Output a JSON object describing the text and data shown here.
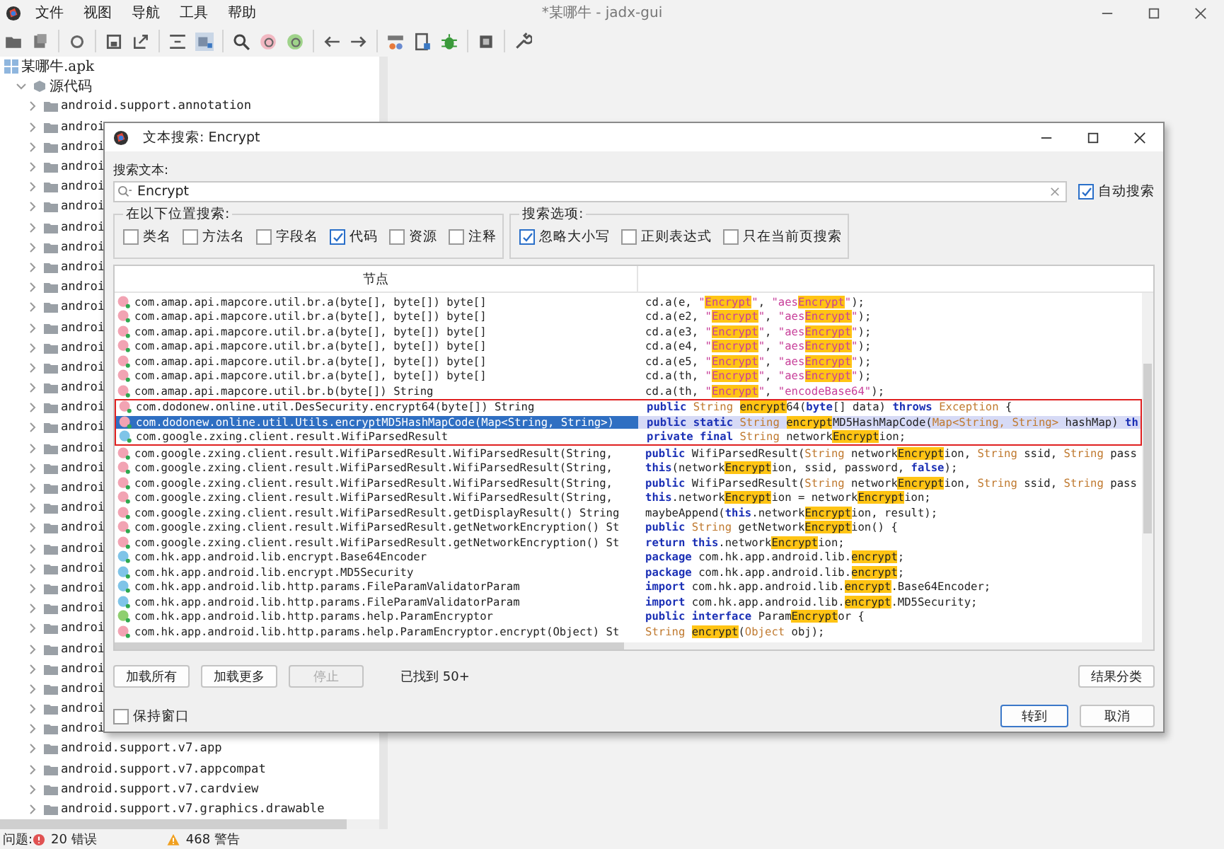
{
  "window": {
    "title": "*某哪牛 - jadx-gui"
  },
  "menu": [
    "文件",
    "视图",
    "导航",
    "工具",
    "帮助"
  ],
  "tree": [
    {
      "label": "某哪牛.apk",
      "kind": "apk",
      "children": [
        {
          "label": "源代码",
          "kind": "sources",
          "expanded": true,
          "children": [
            {
              "label": "android.support.annotation",
              "kind": "package",
              "expanded": false
            },
            {
              "label": "androi",
              "kind": "package",
              "expanded": false
            },
            {
              "label": "androi",
              "kind": "package",
              "expanded": false
            },
            {
              "label": "androi",
              "kind": "package",
              "expanded": false
            },
            {
              "label": "androi",
              "kind": "package",
              "expanded": false
            },
            {
              "label": "androi",
              "kind": "package",
              "expanded": false
            },
            {
              "label": "androi",
              "kind": "package",
              "expanded": false
            },
            {
              "label": "androi",
              "kind": "package",
              "expanded": false
            },
            {
              "label": "androi",
              "kind": "package",
              "expanded": false
            },
            {
              "label": "androi",
              "kind": "package",
              "expanded": false
            },
            {
              "label": "androi",
              "kind": "package",
              "expanded": false
            },
            {
              "label": "androi",
              "kind": "package",
              "expanded": false
            },
            {
              "label": "androi",
              "kind": "package",
              "expanded": false
            },
            {
              "label": "androi",
              "kind": "package",
              "expanded": false
            },
            {
              "label": "androi",
              "kind": "package",
              "expanded": false
            },
            {
              "label": "androi",
              "kind": "package",
              "expanded": false
            },
            {
              "label": "androi",
              "kind": "package",
              "expanded": false
            },
            {
              "label": "androi",
              "kind": "package",
              "expanded": false
            },
            {
              "label": "androi",
              "kind": "package",
              "expanded": false
            },
            {
              "label": "androi",
              "kind": "package",
              "expanded": false
            },
            {
              "label": "androi",
              "kind": "package",
              "expanded": false
            },
            {
              "label": "androi",
              "kind": "package",
              "expanded": false
            },
            {
              "label": "androi",
              "kind": "package",
              "expanded": false
            },
            {
              "label": "androi",
              "kind": "package",
              "expanded": false
            },
            {
              "label": "androi",
              "kind": "package",
              "expanded": false
            },
            {
              "label": "androi",
              "kind": "package",
              "expanded": false
            },
            {
              "label": "androi",
              "kind": "package",
              "expanded": false
            },
            {
              "label": "androi",
              "kind": "package",
              "expanded": false
            },
            {
              "label": "androi",
              "kind": "package",
              "expanded": false
            },
            {
              "label": "androi",
              "kind": "package",
              "expanded": false
            },
            {
              "label": "androi",
              "kind": "package",
              "expanded": false
            },
            {
              "label": "androi",
              "kind": "package",
              "expanded": false
            },
            {
              "label": "android.support.v7.app",
              "kind": "package",
              "expanded": false
            },
            {
              "label": "android.support.v7.appcompat",
              "kind": "package",
              "expanded": false
            },
            {
              "label": "android.support.v7.cardview",
              "kind": "package",
              "expanded": false
            },
            {
              "label": "android.support.v7.graphics.drawable",
              "kind": "package",
              "expanded": false
            }
          ]
        }
      ]
    }
  ],
  "dialog": {
    "title": "文本搜索: Encrypt",
    "search_label": "搜索文本:",
    "query": "Encrypt",
    "auto_search": {
      "label": "自动搜索",
      "checked": true
    },
    "scope": {
      "title": "在以下位置搜索:",
      "options": [
        {
          "label": "类名",
          "checked": false
        },
        {
          "label": "方法名",
          "checked": false
        },
        {
          "label": "字段名",
          "checked": false
        },
        {
          "label": "代码",
          "checked": true
        },
        {
          "label": "资源",
          "checked": false
        },
        {
          "label": "注释",
          "checked": false
        }
      ]
    },
    "search_options": {
      "title": "搜索选项:",
      "options": [
        {
          "label": "忽略大小写",
          "checked": true
        },
        {
          "label": "正则表达式",
          "checked": false
        },
        {
          "label": "只在当前页搜索",
          "checked": false
        }
      ]
    },
    "results": {
      "columns": [
        "节点"
      ],
      "rows": [
        {
          "kind": "method",
          "name": "com.amap.api.mapcore.util.br.a(byte[], byte[]) byte[]",
          "selected": false,
          "code": [
            {
              "text": "cd.a(e, ",
              "kind": "plain"
            },
            {
              "text": "\"",
              "kind": "str"
            },
            {
              "text": "Encrypt",
              "kind": "strhit"
            },
            {
              "text": "\"",
              "kind": "str"
            },
            {
              "text": ", ",
              "kind": "plain"
            },
            {
              "text": "\"aes",
              "kind": "str"
            },
            {
              "text": "Encrypt",
              "kind": "strhit"
            },
            {
              "text": "\"",
              "kind": "str"
            },
            {
              "text": ");",
              "kind": "plain"
            }
          ]
        },
        {
          "kind": "method",
          "name": "com.amap.api.mapcore.util.br.a(byte[], byte[]) byte[]",
          "selected": false,
          "code": [
            {
              "text": "cd.a(e2, ",
              "kind": "plain"
            },
            {
              "text": "\"",
              "kind": "str"
            },
            {
              "text": "Encrypt",
              "kind": "strhit"
            },
            {
              "text": "\"",
              "kind": "str"
            },
            {
              "text": ", ",
              "kind": "plain"
            },
            {
              "text": "\"aes",
              "kind": "str"
            },
            {
              "text": "Encrypt",
              "kind": "strhit"
            },
            {
              "text": "\"",
              "kind": "str"
            },
            {
              "text": ");",
              "kind": "plain"
            }
          ]
        },
        {
          "kind": "method",
          "name": "com.amap.api.mapcore.util.br.a(byte[], byte[]) byte[]",
          "selected": false,
          "code": [
            {
              "text": "cd.a(e3, ",
              "kind": "plain"
            },
            {
              "text": "\"",
              "kind": "str"
            },
            {
              "text": "Encrypt",
              "kind": "strhit"
            },
            {
              "text": "\"",
              "kind": "str"
            },
            {
              "text": ", ",
              "kind": "plain"
            },
            {
              "text": "\"aes",
              "kind": "str"
            },
            {
              "text": "Encrypt",
              "kind": "strhit"
            },
            {
              "text": "\"",
              "kind": "str"
            },
            {
              "text": ");",
              "kind": "plain"
            }
          ]
        },
        {
          "kind": "method",
          "name": "com.amap.api.mapcore.util.br.a(byte[], byte[]) byte[]",
          "selected": false,
          "code": [
            {
              "text": "cd.a(e4, ",
              "kind": "plain"
            },
            {
              "text": "\"",
              "kind": "str"
            },
            {
              "text": "Encrypt",
              "kind": "strhit"
            },
            {
              "text": "\"",
              "kind": "str"
            },
            {
              "text": ", ",
              "kind": "plain"
            },
            {
              "text": "\"aes",
              "kind": "str"
            },
            {
              "text": "Encrypt",
              "kind": "strhit"
            },
            {
              "text": "\"",
              "kind": "str"
            },
            {
              "text": ");",
              "kind": "plain"
            }
          ]
        },
        {
          "kind": "method",
          "name": "com.amap.api.mapcore.util.br.a(byte[], byte[]) byte[]",
          "selected": false,
          "code": [
            {
              "text": "cd.a(e5, ",
              "kind": "plain"
            },
            {
              "text": "\"",
              "kind": "str"
            },
            {
              "text": "Encrypt",
              "kind": "strhit"
            },
            {
              "text": "\"",
              "kind": "str"
            },
            {
              "text": ", ",
              "kind": "plain"
            },
            {
              "text": "\"aes",
              "kind": "str"
            },
            {
              "text": "Encrypt",
              "kind": "strhit"
            },
            {
              "text": "\"",
              "kind": "str"
            },
            {
              "text": ");",
              "kind": "plain"
            }
          ]
        },
        {
          "kind": "method",
          "name": "com.amap.api.mapcore.util.br.a(byte[], byte[]) byte[]",
          "selected": false,
          "code": [
            {
              "text": "cd.a(th, ",
              "kind": "plain"
            },
            {
              "text": "\"",
              "kind": "str"
            },
            {
              "text": "Encrypt",
              "kind": "strhit"
            },
            {
              "text": "\"",
              "kind": "str"
            },
            {
              "text": ", ",
              "kind": "plain"
            },
            {
              "text": "\"aes",
              "kind": "str"
            },
            {
              "text": "Encrypt",
              "kind": "strhit"
            },
            {
              "text": "\"",
              "kind": "str"
            },
            {
              "text": ");",
              "kind": "plain"
            }
          ]
        },
        {
          "kind": "method",
          "name": "com.amap.api.mapcore.util.br.b(byte[]) String",
          "selected": false,
          "code": [
            {
              "text": "cd.a(th, ",
              "kind": "plain"
            },
            {
              "text": "\"",
              "kind": "str"
            },
            {
              "text": "Encrypt",
              "kind": "strhit"
            },
            {
              "text": "\"",
              "kind": "str"
            },
            {
              "text": ", ",
              "kind": "plain"
            },
            {
              "text": "\"encodeBase64\"",
              "kind": "str"
            },
            {
              "text": ");",
              "kind": "plain"
            }
          ]
        },
        {
          "kind": "method",
          "name": "com.dodonew.online.util.DesSecurity.encrypt64(byte[]) String",
          "selected": false,
          "code": [
            {
              "text": "public ",
              "kind": "kw"
            },
            {
              "text": "String ",
              "kind": "type"
            },
            {
              "text": "encrypt",
              "kind": "hit"
            },
            {
              "text": "64(",
              "kind": "plain"
            },
            {
              "text": "byte",
              "kind": "kw"
            },
            {
              "text": "[] data) ",
              "kind": "plain"
            },
            {
              "text": "throws ",
              "kind": "kw"
            },
            {
              "text": "Exception ",
              "kind": "type"
            },
            {
              "text": "{",
              "kind": "plain"
            }
          ]
        },
        {
          "kind": "method",
          "name": "com.dodonew.online.util.Utils.encryptMD5HashMapCode(Map<String, String>)",
          "selected": true,
          "code": [
            {
              "text": "public static ",
              "kind": "kw"
            },
            {
              "text": "String ",
              "kind": "type"
            },
            {
              "text": "encrypt",
              "kind": "hit"
            },
            {
              "text": "MD5HashMapCode(",
              "kind": "plain"
            },
            {
              "text": "Map<String, String> ",
              "kind": "type"
            },
            {
              "text": "hashMap) ",
              "kind": "plain"
            },
            {
              "text": "th",
              "kind": "kw"
            }
          ]
        },
        {
          "kind": "class",
          "name": "com.google.zxing.client.result.WifiParsedResult",
          "selected": false,
          "code": [
            {
              "text": "private final ",
              "kind": "kw"
            },
            {
              "text": "String ",
              "kind": "type"
            },
            {
              "text": "network",
              "kind": "plain"
            },
            {
              "text": "Encrypt",
              "kind": "hit"
            },
            {
              "text": "ion;",
              "kind": "plain"
            }
          ]
        },
        {
          "kind": "method",
          "name": "com.google.zxing.client.result.WifiParsedResult.WifiParsedResult(String,",
          "selected": false,
          "code": [
            {
              "text": "public ",
              "kind": "kw"
            },
            {
              "text": "WifiParsedResult(",
              "kind": "plain"
            },
            {
              "text": "String ",
              "kind": "type"
            },
            {
              "text": "network",
              "kind": "plain"
            },
            {
              "text": "Encrypt",
              "kind": "hit"
            },
            {
              "text": "ion, ",
              "kind": "plain"
            },
            {
              "text": "String ",
              "kind": "type"
            },
            {
              "text": "ssid, ",
              "kind": "plain"
            },
            {
              "text": "String ",
              "kind": "type"
            },
            {
              "text": "pass",
              "kind": "plain"
            }
          ]
        },
        {
          "kind": "method",
          "name": "com.google.zxing.client.result.WifiParsedResult.WifiParsedResult(String,",
          "selected": false,
          "code": [
            {
              "text": "this",
              "kind": "kw"
            },
            {
              "text": "(network",
              "kind": "plain"
            },
            {
              "text": "Encrypt",
              "kind": "hit"
            },
            {
              "text": "ion, ssid, password, ",
              "kind": "plain"
            },
            {
              "text": "false",
              "kind": "kw"
            },
            {
              "text": ");",
              "kind": "plain"
            }
          ]
        },
        {
          "kind": "method",
          "name": "com.google.zxing.client.result.WifiParsedResult.WifiParsedResult(String,",
          "selected": false,
          "code": [
            {
              "text": "public ",
              "kind": "kw"
            },
            {
              "text": "WifiParsedResult(",
              "kind": "plain"
            },
            {
              "text": "String ",
              "kind": "type"
            },
            {
              "text": "network",
              "kind": "plain"
            },
            {
              "text": "Encrypt",
              "kind": "hit"
            },
            {
              "text": "ion, ",
              "kind": "plain"
            },
            {
              "text": "String ",
              "kind": "type"
            },
            {
              "text": "ssid, ",
              "kind": "plain"
            },
            {
              "text": "String ",
              "kind": "type"
            },
            {
              "text": "pass",
              "kind": "plain"
            }
          ]
        },
        {
          "kind": "method",
          "name": "com.google.zxing.client.result.WifiParsedResult.WifiParsedResult(String,",
          "selected": false,
          "code": [
            {
              "text": "this",
              "kind": "kw"
            },
            {
              "text": ".network",
              "kind": "plain"
            },
            {
              "text": "Encrypt",
              "kind": "hit"
            },
            {
              "text": "ion = network",
              "kind": "plain"
            },
            {
              "text": "Encrypt",
              "kind": "hit"
            },
            {
              "text": "ion;",
              "kind": "plain"
            }
          ]
        },
        {
          "kind": "method",
          "name": "com.google.zxing.client.result.WifiParsedResult.getDisplayResult() String",
          "selected": false,
          "code": [
            {
              "text": "maybeAppend(",
              "kind": "plain"
            },
            {
              "text": "this",
              "kind": "kw"
            },
            {
              "text": ".network",
              "kind": "plain"
            },
            {
              "text": "Encrypt",
              "kind": "hit"
            },
            {
              "text": "ion, result);",
              "kind": "plain"
            }
          ]
        },
        {
          "kind": "method",
          "name": "com.google.zxing.client.result.WifiParsedResult.getNetworkEncryption() St",
          "selected": false,
          "code": [
            {
              "text": "public ",
              "kind": "kw"
            },
            {
              "text": "String ",
              "kind": "type"
            },
            {
              "text": "getNetwork",
              "kind": "plain"
            },
            {
              "text": "Encrypt",
              "kind": "hit"
            },
            {
              "text": "ion() {",
              "kind": "plain"
            }
          ]
        },
        {
          "kind": "method",
          "name": "com.google.zxing.client.result.WifiParsedResult.getNetworkEncryption() St",
          "selected": false,
          "code": [
            {
              "text": "return this",
              "kind": "kw"
            },
            {
              "text": ".network",
              "kind": "plain"
            },
            {
              "text": "Encrypt",
              "kind": "hit"
            },
            {
              "text": "ion;",
              "kind": "plain"
            }
          ]
        },
        {
          "kind": "class",
          "name": "com.hk.app.android.lib.encrypt.Base64Encoder",
          "selected": false,
          "code": [
            {
              "text": "package ",
              "kind": "kw"
            },
            {
              "text": "com.hk.app.android.lib.",
              "kind": "plain"
            },
            {
              "text": "encrypt",
              "kind": "hit"
            },
            {
              "text": ";",
              "kind": "plain"
            }
          ]
        },
        {
          "kind": "class",
          "name": "com.hk.app.android.lib.encrypt.MD5Security",
          "selected": false,
          "code": [
            {
              "text": "package ",
              "kind": "kw"
            },
            {
              "text": "com.hk.app.android.lib.",
              "kind": "plain"
            },
            {
              "text": "encrypt",
              "kind": "hit"
            },
            {
              "text": ";",
              "kind": "plain"
            }
          ]
        },
        {
          "kind": "class",
          "name": "com.hk.app.android.lib.http.params.FileParamValidatorParam",
          "selected": false,
          "code": [
            {
              "text": "import ",
              "kind": "kw"
            },
            {
              "text": "com.hk.app.android.lib.",
              "kind": "plain"
            },
            {
              "text": "encrypt",
              "kind": "hit"
            },
            {
              "text": ".Base64Encoder;",
              "kind": "plain"
            }
          ]
        },
        {
          "kind": "class",
          "name": "com.hk.app.android.lib.http.params.FileParamValidatorParam",
          "selected": false,
          "code": [
            {
              "text": "import ",
              "kind": "kw"
            },
            {
              "text": "com.hk.app.android.lib.",
              "kind": "plain"
            },
            {
              "text": "encrypt",
              "kind": "hit"
            },
            {
              "text": ".MD5Security;",
              "kind": "plain"
            }
          ]
        },
        {
          "kind": "interface",
          "name": "com.hk.app.android.lib.http.params.help.ParamEncryptor",
          "selected": false,
          "code": [
            {
              "text": "public interface ",
              "kind": "kw"
            },
            {
              "text": "Param",
              "kind": "plain"
            },
            {
              "text": "Encrypt",
              "kind": "hit"
            },
            {
              "text": "or {",
              "kind": "plain"
            }
          ]
        },
        {
          "kind": "method",
          "name": "com.hk.app.android.lib.http.params.help.ParamEncryptor.encrypt(Object) St",
          "selected": false,
          "code": [
            {
              "text": "String ",
              "kind": "type"
            },
            {
              "text": "encrypt",
              "kind": "hit"
            },
            {
              "text": "(",
              "kind": "plain"
            },
            {
              "text": "Object ",
              "kind": "type"
            },
            {
              "text": "obj);",
              "kind": "plain"
            }
          ]
        }
      ]
    },
    "buttons": [
      {
        "label": "加载所有",
        "disabled": false
      },
      {
        "label": "加载更多",
        "disabled": false
      },
      {
        "label": "停止",
        "disabled": true
      }
    ],
    "found": "已找到 50+",
    "group_button": "结果分类",
    "keep_window": {
      "label": "保持窗口",
      "checked": false
    },
    "goto_button": "转到",
    "cancel_button": "取消"
  },
  "status_bar": {
    "label": "问题:",
    "errors": "20 错误",
    "warnings": "468 警告"
  }
}
